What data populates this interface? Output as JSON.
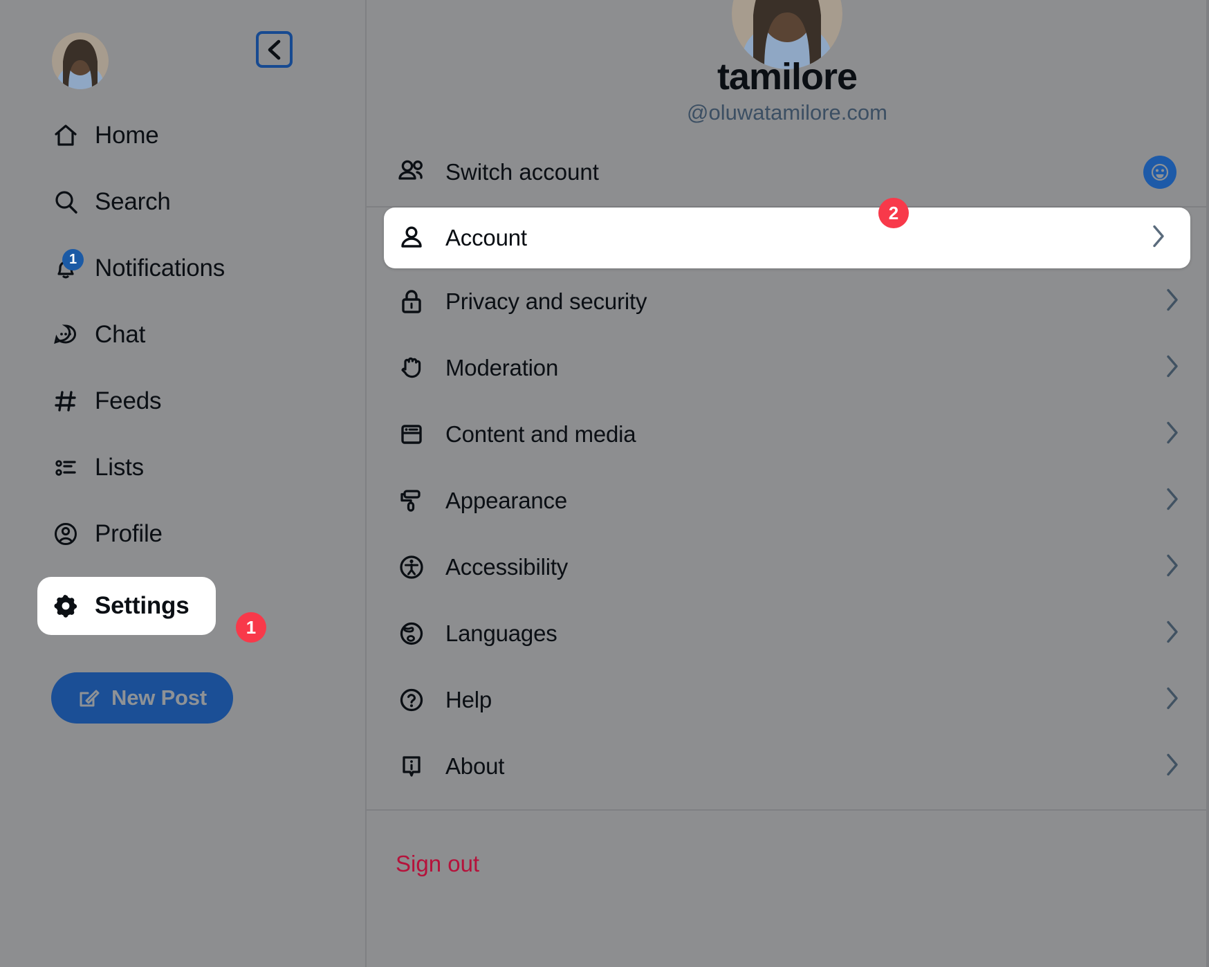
{
  "sidebar": {
    "avatar_name": "user-avatar-photo",
    "back_button_icon": "chevron-left-icon",
    "items": [
      {
        "label": "Home",
        "icon": "home-icon",
        "badge": null,
        "active": false
      },
      {
        "label": "Search",
        "icon": "search-icon",
        "badge": null,
        "active": false
      },
      {
        "label": "Notifications",
        "icon": "bell-icon",
        "badge": "1",
        "active": false
      },
      {
        "label": "Chat",
        "icon": "chat-bubble-icon",
        "badge": null,
        "active": false
      },
      {
        "label": "Feeds",
        "icon": "hashtag-icon",
        "badge": null,
        "active": false
      },
      {
        "label": "Lists",
        "icon": "list-icon",
        "badge": null,
        "active": false
      },
      {
        "label": "Profile",
        "icon": "user-circle-icon",
        "badge": null,
        "active": false
      },
      {
        "label": "Settings",
        "icon": "gear-icon",
        "badge": null,
        "active": true
      }
    ],
    "new_post": {
      "label": "New Post",
      "icon": "compose-icon"
    }
  },
  "annotations": {
    "step_one": "1",
    "step_two": "2"
  },
  "profile": {
    "display_name": "tamilore",
    "handle": "@oluwatamilore.com",
    "avatar_name": "profile-avatar-photo"
  },
  "switch_account": {
    "label": "Switch account",
    "icon": "users-icon",
    "avatar_icon": "smiley-face-avatar-icon"
  },
  "settings": {
    "items": [
      {
        "label": "Account",
        "icon": "person-icon",
        "highlight": true
      },
      {
        "label": "Privacy and security",
        "icon": "lock-icon",
        "highlight": false
      },
      {
        "label": "Moderation",
        "icon": "raised-hand-icon",
        "highlight": false
      },
      {
        "label": "Content and media",
        "icon": "window-icon",
        "highlight": false
      },
      {
        "label": "Appearance",
        "icon": "paint-roller-icon",
        "highlight": false
      },
      {
        "label": "Accessibility",
        "icon": "accessibility-icon",
        "highlight": false
      },
      {
        "label": "Languages",
        "icon": "globe-icon",
        "highlight": false
      },
      {
        "label": "Help",
        "icon": "question-mark-icon",
        "highlight": false
      },
      {
        "label": "About",
        "icon": "info-icon",
        "highlight": false
      }
    ],
    "chevron_icon": "chevron-right-icon",
    "sign_out_label": "Sign out"
  },
  "colors": {
    "background": "#8d8e90",
    "accent_blue": "#1b4f96",
    "badge_red": "#f8394a",
    "badge_blue": "#1b5aa5",
    "sign_out_red": "#b5123b",
    "divider": "#7f8083",
    "highlight_white": "#ffffff"
  }
}
